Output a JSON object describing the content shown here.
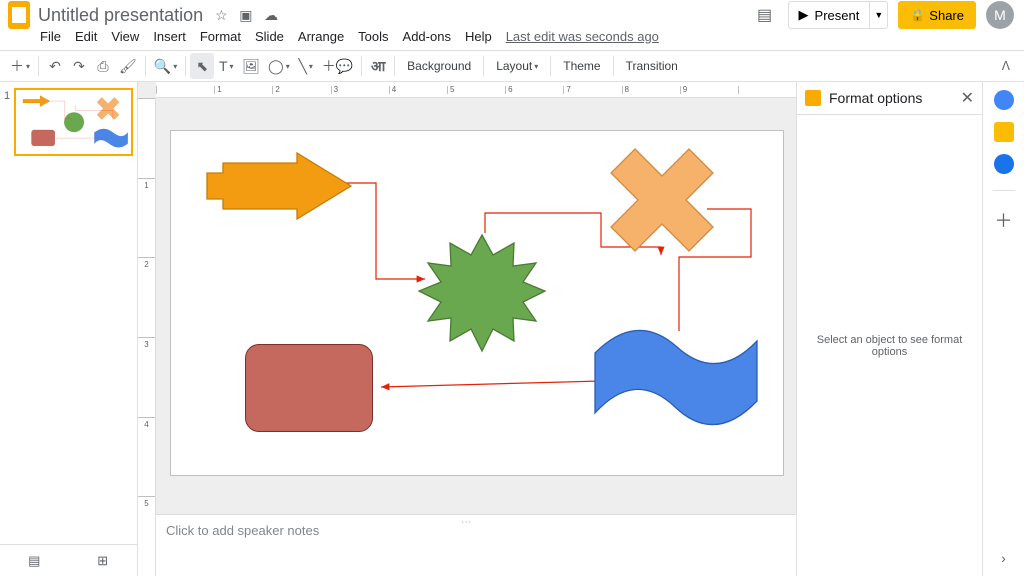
{
  "header": {
    "title": "Untitled presentation",
    "star_icon": "☆",
    "move_icon": "▣",
    "cloud_icon": "☁",
    "comment_icon": "▤",
    "present_label": "Present",
    "share_label": "Share",
    "avatar_initial": "M"
  },
  "menu": {
    "items": [
      "File",
      "Edit",
      "View",
      "Insert",
      "Format",
      "Slide",
      "Arrange",
      "Tools",
      "Add-ons",
      "Help"
    ],
    "edit_status": "Last edit was seconds ago"
  },
  "toolbar": {
    "background": "Background",
    "layout": "Layout",
    "theme": "Theme",
    "transition": "Transition"
  },
  "filmstrip": {
    "slides": [
      {
        "number": "1"
      }
    ]
  },
  "ruler_h": [
    "",
    "1",
    "2",
    "3",
    "4",
    "5",
    "6",
    "7",
    "8",
    "9",
    ""
  ],
  "ruler_v": [
    "",
    "1",
    "2",
    "3",
    "4",
    "5"
  ],
  "speaker_notes": {
    "placeholder": "Click to add speaker notes"
  },
  "sidebar": {
    "title": "Format options",
    "empty": "Select an object to see format options"
  },
  "shapes": {
    "arrow_fill": "#f39c12",
    "arrow_stroke": "#c77c06",
    "starburst_fill": "#6aa84f",
    "starburst_stroke": "#4a7a34",
    "cross_fill": "#f6b26b",
    "cross_stroke": "#d08a3f",
    "roundrect_fill": "#c5695e",
    "roundrect_stroke": "#7a3028",
    "wave_fill": "#4a86e8",
    "wave_stroke": "#2b5db0",
    "connector_color": "#e52207"
  }
}
